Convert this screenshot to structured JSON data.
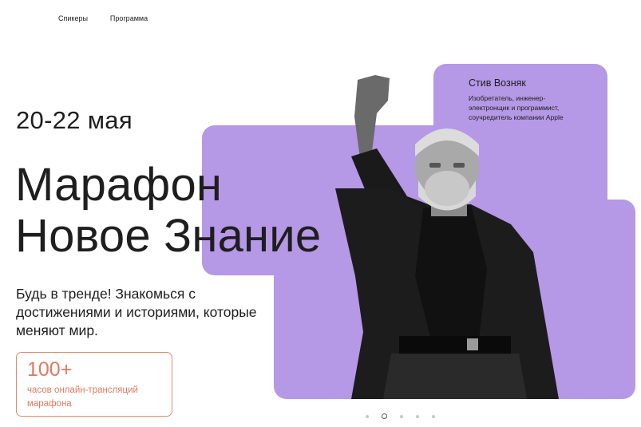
{
  "nav": {
    "items": [
      {
        "label": "Спикеры"
      },
      {
        "label": "Программа"
      }
    ]
  },
  "event": {
    "date": "20-22 мая",
    "title_line1": "Марафон",
    "title_line2": "Новое Знание",
    "subtitle": "Будь в тренде! Знакомься с достижениями и историями, которые меняют мир."
  },
  "stat": {
    "value": "100+",
    "label": "часов онлайн-трансляций марафона"
  },
  "speaker": {
    "name": "Стив Возняк",
    "role": "Изобретатель, инженер-электронщик и программист, соучредитель компании Apple"
  },
  "slider": {
    "count": 5,
    "active_index": 1
  },
  "colors": {
    "accent_purple": "#b598e6",
    "stat_coral": "#e07a5f"
  }
}
